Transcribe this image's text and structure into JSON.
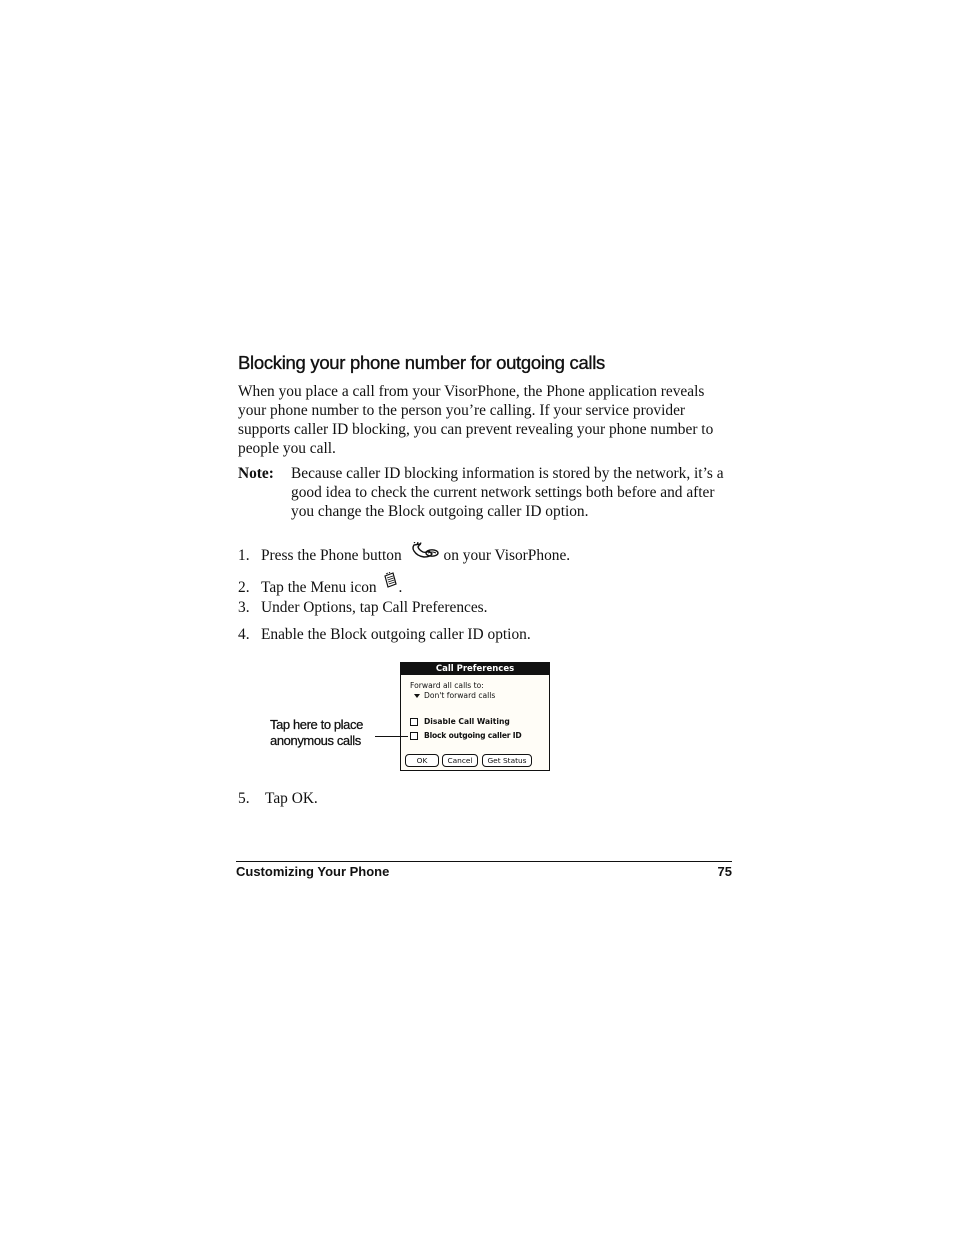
{
  "section": {
    "heading": "Blocking your phone number for outgoing calls",
    "paragraph": "When you place a call from your VisorPhone, the Phone application reveals your phone number to the person you’re calling. If your service provider supports caller ID blocking, you can prevent revealing your phone number to people you call."
  },
  "note": {
    "label": "Note:",
    "text": "Because caller ID blocking information is stored by the network, it’s a good idea to check the current network settings both before and after you change the Block outgoing caller ID option."
  },
  "steps": [
    {
      "num": "1.",
      "before": "Press the Phone button",
      "icon": "phone-button-icon",
      "after": "on your VisorPhone."
    },
    {
      "num": "2.",
      "before": "Tap the Menu icon",
      "icon": "menu-icon",
      "after": "."
    },
    {
      "num": "3.",
      "text": "Under Options, tap Call Preferences."
    },
    {
      "num": "4.",
      "text": "Enable the Block outgoing caller ID option."
    },
    {
      "num": "5.",
      "text": "Tap OK."
    }
  ],
  "figure": {
    "title": "Call Preferences",
    "forward_label": "Forward all calls to:",
    "forward_value": "Don't forward calls",
    "option_waiting": "Disable Call Waiting",
    "option_block": "Block outgoing caller ID",
    "buttons": {
      "ok": "OK",
      "cancel": "Cancel",
      "status": "Get Status"
    },
    "callout_line1": "Tap here to place",
    "callout_line2": "anonymous calls"
  },
  "footer": {
    "chapter": "Customizing Your Phone",
    "page_number": "75"
  }
}
